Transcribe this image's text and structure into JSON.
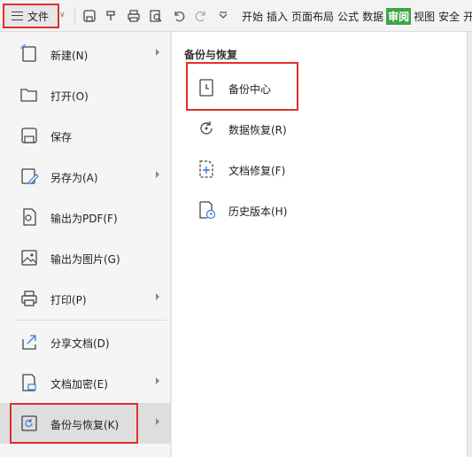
{
  "toolbar": {
    "file_label": "文件",
    "dropdown_glyph": "∨",
    "tabs": [
      "开始",
      "插入",
      "页面布局",
      "公式",
      "数据",
      "审阅",
      "视图",
      "安全",
      "开"
    ],
    "active_tab": "审阅",
    "active_tab_color": "#3ea547"
  },
  "menu": {
    "items": [
      {
        "label": "新建(N)",
        "icon": "new-icon",
        "has_submenu": true
      },
      {
        "label": "打开(O)",
        "icon": "open-folder-icon",
        "has_submenu": false
      },
      {
        "label": "保存",
        "icon": "save-icon",
        "has_submenu": false
      },
      {
        "label": "另存为(A)",
        "icon": "save-as-icon",
        "has_submenu": true
      },
      {
        "label": "输出为PDF(F)",
        "icon": "export-pdf-icon",
        "has_submenu": false
      },
      {
        "label": "输出为图片(G)",
        "icon": "export-image-icon",
        "has_submenu": false
      },
      {
        "label": "打印(P)",
        "icon": "print-icon",
        "has_submenu": true
      },
      {
        "label": "分享文档(D)",
        "icon": "share-icon",
        "has_submenu": false
      },
      {
        "label": "文档加密(E)",
        "icon": "encrypt-icon",
        "has_submenu": true
      },
      {
        "label": "备份与恢复(K)",
        "icon": "backup-restore-icon",
        "has_submenu": true,
        "selected": true
      }
    ]
  },
  "panel": {
    "title": "备份与恢复",
    "items": [
      {
        "label": "备份中心",
        "icon": "backup-center-icon"
      },
      {
        "label": "数据恢复(R)",
        "icon": "data-recovery-icon"
      },
      {
        "label": "文档修复(F)",
        "icon": "document-repair-icon"
      },
      {
        "label": "历史版本(H)",
        "icon": "history-version-icon"
      }
    ]
  },
  "colors": {
    "highlight_border": "#e0302a",
    "menu_bg": "#f5f5f5",
    "selected_bg": "#dedede"
  }
}
